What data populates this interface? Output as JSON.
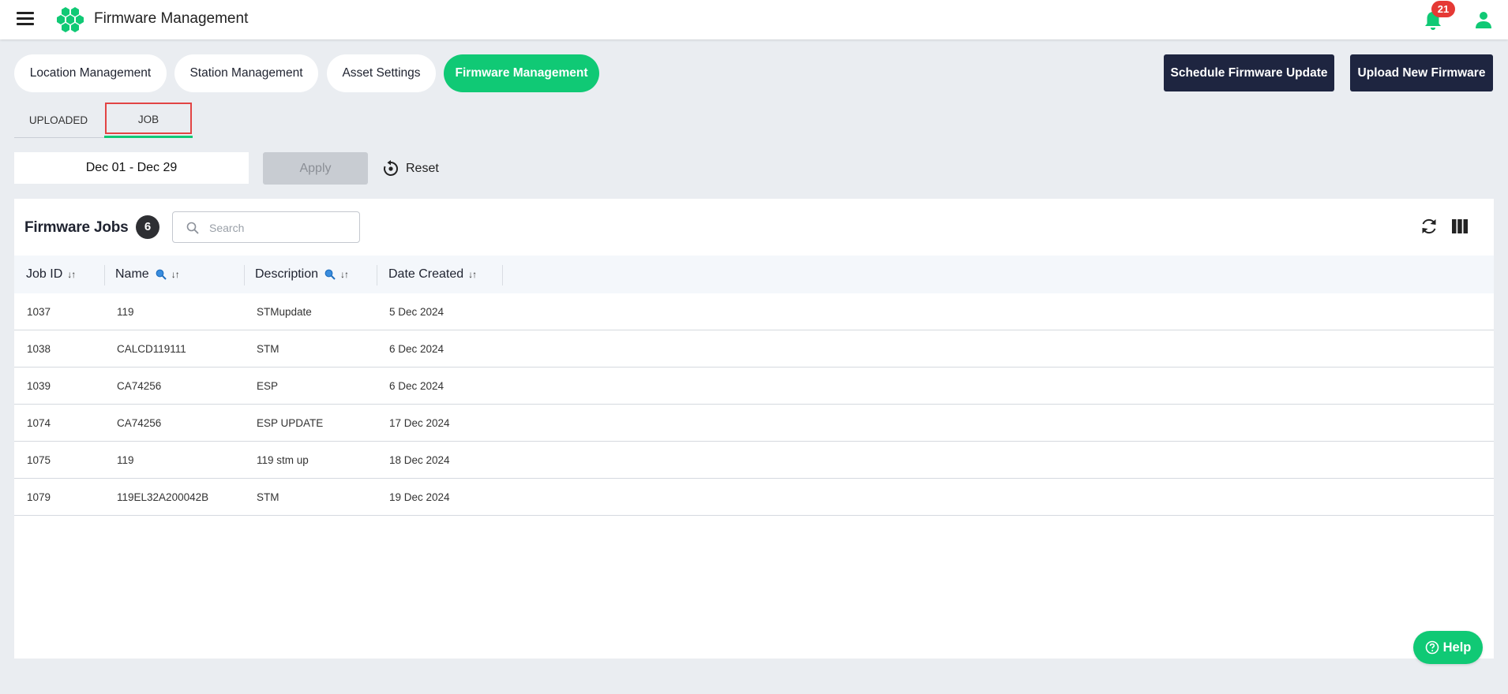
{
  "app": {
    "title": "Firmware Management",
    "notification_count": "21",
    "accent_color": "#10c975",
    "dark_button_color": "#1e2540",
    "alert_color": "#e53935"
  },
  "nav": {
    "tabs": [
      {
        "label": "Location Management",
        "active": false
      },
      {
        "label": "Station Management",
        "active": false
      },
      {
        "label": "Asset Settings",
        "active": false
      },
      {
        "label": "Firmware Management",
        "active": true
      }
    ],
    "schedule_label": "Schedule Firmware Update",
    "upload_label": "Upload New Firmware"
  },
  "subtabs": [
    {
      "label": "UPLOADED",
      "active": false
    },
    {
      "label": "JOB",
      "active": true
    }
  ],
  "filters": {
    "date_range": "Dec 01 - Dec 29",
    "apply_label": "Apply",
    "reset_label": "Reset"
  },
  "table": {
    "title": "Firmware Jobs",
    "count": "6",
    "search_placeholder": "Search",
    "columns": [
      "Job ID",
      "Name",
      "Description",
      "Date Created"
    ],
    "rows": [
      [
        "1037",
        "119",
        "STMupdate",
        "5 Dec 2024"
      ],
      [
        "1038",
        "CALCD119111",
        "STM",
        "6 Dec 2024"
      ],
      [
        "1039",
        "CA74256",
        "ESP",
        "6 Dec 2024"
      ],
      [
        "1074",
        "CA74256",
        "ESP UPDATE",
        "17 Dec 2024"
      ],
      [
        "1075",
        "119",
        "119 stm up",
        "18 Dec 2024"
      ],
      [
        "1079",
        "119EL32A200042B",
        "STM",
        "19 Dec 2024"
      ]
    ]
  },
  "help": {
    "label": "Help"
  },
  "icons": {
    "menu": "hamburger-menu-icon",
    "logo": "hexagon-cluster-logo",
    "notifications": "bell-icon",
    "user": "user-icon",
    "reset": "reset-icon",
    "search": "search-icon",
    "refresh": "refresh-icon",
    "columns": "columns-icon",
    "help": "question-circle-icon"
  }
}
